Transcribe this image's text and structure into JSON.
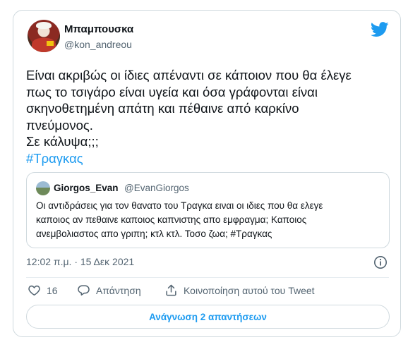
{
  "author": {
    "display_name": "Μπαμπουσκα",
    "handle": "@kon_andreou"
  },
  "tweet": {
    "lines": [
      "Είναι ακριβώς οι ίδιες απέναντι σε κάποιον που θα έλεγε",
      "πως το τσιγάρο είναι υγεία και όσα γράφονται είναι",
      "σκηνοθετημένη απάτη και πέθαινε από καρκίνο",
      "πνεύμονος.",
      "Σε κάλυψα;;;"
    ],
    "hashtag": "#Τραγκας"
  },
  "quoted": {
    "display_name": "Giorgos_Evan",
    "handle": "@EvanGiorgos",
    "lines": [
      "Οι αντιδράσεις για τον θανατο του Τραγκα ειναι οι ιδιες που θα ελεγε",
      "καποιος αν πεθαινε καποιος καπνιστης απο εμφραγμα; Καποιος",
      "ανεμβολιαστος απο γριπη; κτλ κτλ. Τοσο ζωα; #Τραγκας"
    ]
  },
  "meta": {
    "timestamp": "12:02 π.μ. · 15 Δεκ 2021"
  },
  "actions": {
    "likes_count": "16",
    "reply_label": "Απάντηση",
    "share_label": "Κοινοποίηση αυτού του Tweet"
  },
  "read_replies_label": "Ανάγνωση 2 απαντήσεων",
  "colors": {
    "accent": "#1d9bf0",
    "text": "#0f1419",
    "muted": "#536471",
    "border": "#cfd9de"
  },
  "icons": [
    "twitter-bird-icon",
    "info-icon",
    "heart-icon",
    "reply-icon",
    "share-icon"
  ]
}
